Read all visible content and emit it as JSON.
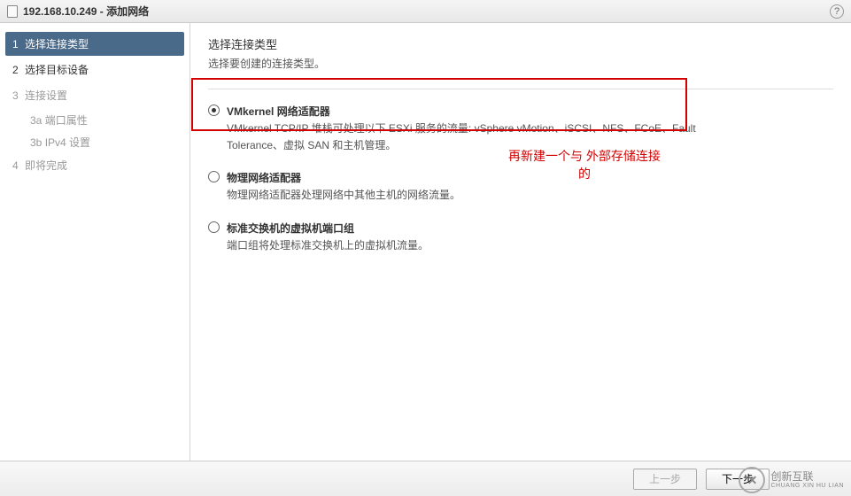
{
  "window": {
    "title": "192.168.10.249 - 添加网络"
  },
  "sidebar": {
    "steps": [
      {
        "num": "1",
        "label": "选择连接类型",
        "active": true
      },
      {
        "num": "2",
        "label": "选择目标设备",
        "active": false
      },
      {
        "num": "3",
        "label": "连接设置",
        "active": false
      },
      {
        "num": "4",
        "label": "即将完成",
        "active": false
      }
    ],
    "substeps": [
      {
        "num": "3a",
        "label": "端口属性"
      },
      {
        "num": "3b",
        "label": "IPv4 设置"
      }
    ]
  },
  "content": {
    "title": "选择连接类型",
    "subtitle": "选择要创建的连接类型。",
    "options": [
      {
        "label": "VMkernel 网络适配器",
        "desc": "VMkernel TCP/IP 堆栈可处理以下 ESXi 服务的流量: vSphere vMotion、iSCSI、NFS、FCoE、Fault Tolerance、虚拟 SAN 和主机管理。",
        "checked": true
      },
      {
        "label": "物理网络适配器",
        "desc": "物理网络适配器处理网络中其他主机的网络流量。",
        "checked": false
      },
      {
        "label": "标准交换机的虚拟机端口组",
        "desc": "端口组将处理标准交换机上的虚拟机流量。",
        "checked": false
      }
    ]
  },
  "annotation": {
    "line1": "再新建一个与  外部存储连接",
    "line2": "的"
  },
  "footer": {
    "back": "上一步",
    "next": "下一步"
  },
  "watermark": {
    "main": "创新互联",
    "sub": "CHUANG XIN HU LIAN"
  }
}
